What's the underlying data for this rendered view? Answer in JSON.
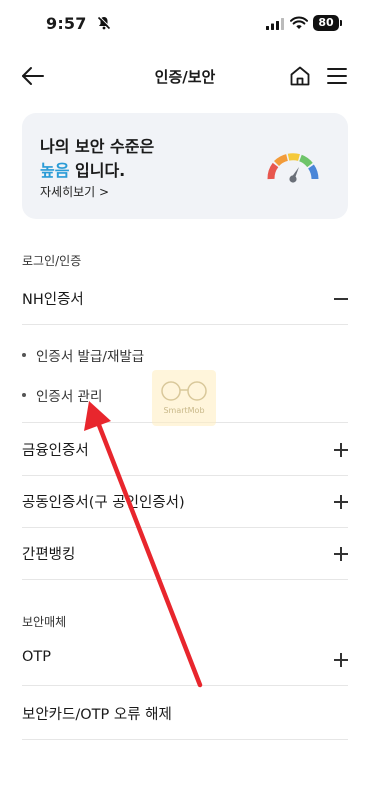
{
  "status_bar": {
    "time": "9:57",
    "battery": "80",
    "icons": [
      "bell-slash-icon",
      "signal-icon",
      "wifi-icon",
      "battery-icon"
    ]
  },
  "header": {
    "title": "인증/보안",
    "icons": [
      "back-arrow-icon",
      "home-icon",
      "hamburger-menu-icon"
    ]
  },
  "security_card": {
    "line1": "나의 보안 수준은",
    "level": "높음",
    "line2_suffix": " 입니다.",
    "detail_link": "자세히보기 >",
    "level_color": "#2a9bd6",
    "icon": "security-gauge-icon"
  },
  "sections": {
    "login_auth_label": "로그인/인증",
    "security_media_label": "보안매체"
  },
  "rows": {
    "nh_cert": "NH인증서",
    "nh_sub_items": [
      "인증서 발급/재발급",
      "인증서 관리"
    ],
    "financial_cert": "금융인증서",
    "joint_cert": "공동인증서(구 공인인증서)",
    "simple_banking": "간편뱅킹",
    "otp": "OTP",
    "card_otp_error": "보안카드/OTP 오류 해제"
  },
  "watermark": {
    "text": "SmartMob"
  },
  "annotation": {
    "arrow_color": "#e8262d"
  }
}
